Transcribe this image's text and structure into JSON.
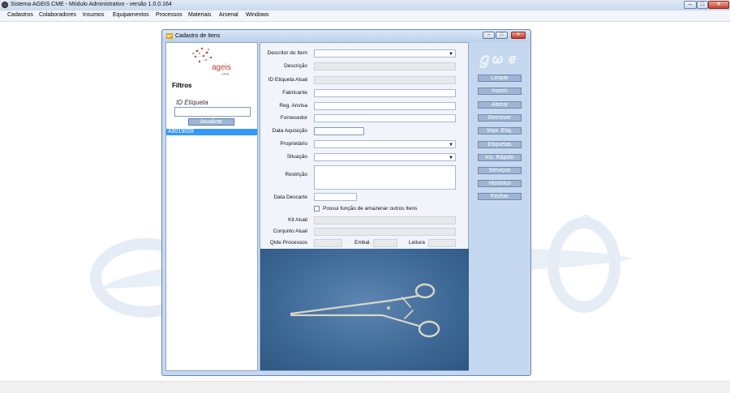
{
  "window": {
    "title": "Sistema AGEIS CME - Módulo Administrativo - versão 1.0.0.164",
    "min": "–",
    "max": "□",
    "close": "✕"
  },
  "menu": {
    "items": [
      "Cadastros",
      "Colaboradores",
      "Insumos",
      "Equipamentos",
      "Processos",
      "Materiais",
      "Arsenal",
      "Windows"
    ]
  },
  "child": {
    "title": "Cadastro de Itens",
    "min": "–",
    "max": "□",
    "close": "✕"
  },
  "logo": {
    "brand": "ageis",
    "sub": "cme"
  },
  "filters": {
    "title": "Filtros",
    "id_label": "ID Etiqueta",
    "id_value": "",
    "refresh_label": "Atualizar",
    "list_items": [
      "A9019028"
    ],
    "selected_index": 0
  },
  "form": {
    "descritor_label": "Descritor do Item",
    "descricao_label": "Descrição",
    "id_etiqueta_label": "ID Etiqueta Atual",
    "fabricante_label": "Fabricante",
    "anvisa_label": "Reg. Anvisa",
    "fornecedor_label": "Fornecedor",
    "data_aquisicao_label": "Data Aquisição",
    "proprietario_label": "Proprietário",
    "situacao_label": "Situação",
    "restricao_label": "Restrição",
    "data_descarte_label": "Data Descarte",
    "armazenar_label": "Possui função de amazenar outros Itens",
    "kit_label": "Kit Atual",
    "conjunto_label": "Conjunto Atual",
    "qtde_label": "Qtde Processos",
    "embal_label": "Embal.",
    "leitura_label": "Leitura"
  },
  "actions": {
    "limpar": "Limpar",
    "inserir": "Inserir",
    "alterar": "Alterar",
    "remover": "Remover",
    "imprimir": "Impr. Etiq.",
    "etiquetas": "Etiquetas",
    "ins_rapido": "Ins. Rápido",
    "servicos": "Serviços",
    "historico": "Histórico",
    "fechar": "Fechar"
  },
  "colors": {
    "button_bg": "#9fb5d3",
    "selection": "#3399ff",
    "photo_bg": "#3e6895"
  }
}
